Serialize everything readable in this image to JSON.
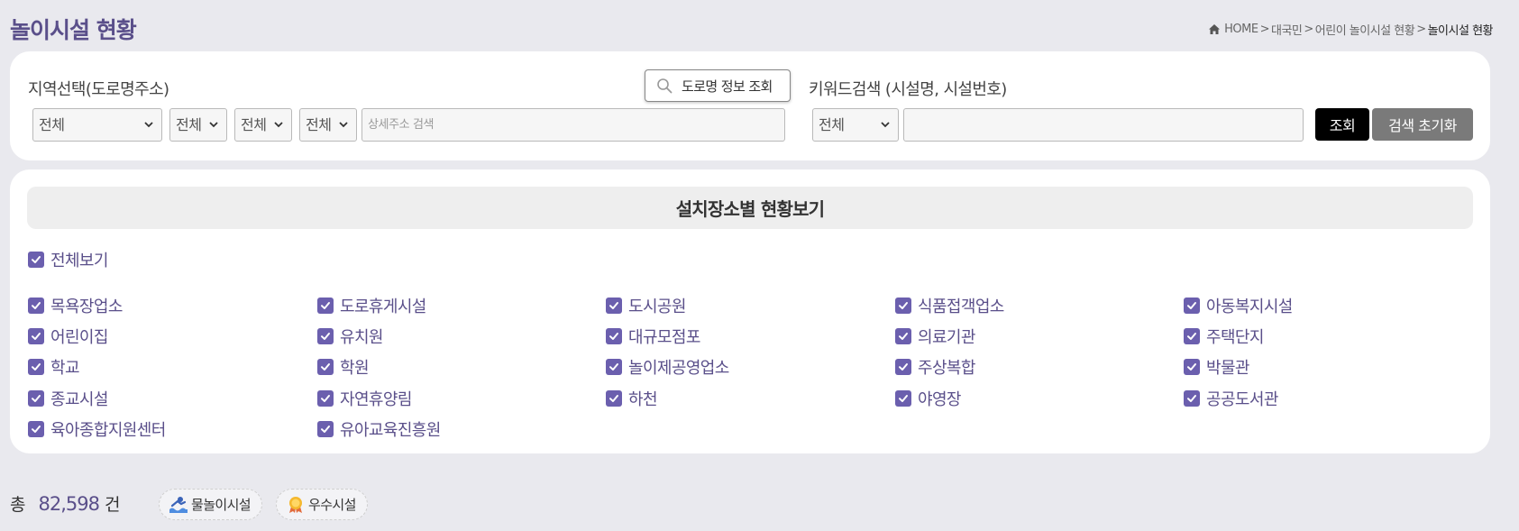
{
  "page": {
    "title": "놀이시설 현황"
  },
  "breadcrumb": {
    "items": [
      "HOME",
      "대국민",
      "어린이 놀이시설 현황"
    ],
    "separator": ">",
    "current": "놀이시설 현황"
  },
  "region_search": {
    "label": "지역선택(도로명주소)",
    "selects": [
      "전체",
      "전체",
      "전체",
      "전체"
    ],
    "detail_placeholder": "상세주소 검색",
    "road_button_label": "도로명 정보 조회"
  },
  "keyword_search": {
    "label": "키워드검색 (시설명, 시설번호)",
    "select_value": "전체",
    "input_value": "",
    "search_button_label": "조회",
    "reset_button_label": "검색 초기화"
  },
  "location_filter": {
    "header": "설치장소별 현황보기",
    "select_all_label": "전체보기",
    "select_all_checked": true,
    "options": [
      {
        "label": "목욕장업소",
        "checked": true
      },
      {
        "label": "도로휴게시설",
        "checked": true
      },
      {
        "label": "도시공원",
        "checked": true
      },
      {
        "label": "식품접객업소",
        "checked": true
      },
      {
        "label": "아동복지시설",
        "checked": true
      },
      {
        "label": "어린이집",
        "checked": true
      },
      {
        "label": "유치원",
        "checked": true
      },
      {
        "label": "대규모점포",
        "checked": true
      },
      {
        "label": "의료기관",
        "checked": true
      },
      {
        "label": "주택단지",
        "checked": true
      },
      {
        "label": "학교",
        "checked": true
      },
      {
        "label": "학원",
        "checked": true
      },
      {
        "label": "놀이제공영업소",
        "checked": true
      },
      {
        "label": "주상복합",
        "checked": true
      },
      {
        "label": "박물관",
        "checked": true
      },
      {
        "label": "종교시설",
        "checked": true
      },
      {
        "label": "자연휴양림",
        "checked": true
      },
      {
        "label": "하천",
        "checked": true
      },
      {
        "label": "야영장",
        "checked": true
      },
      {
        "label": "공공도서관",
        "checked": true
      },
      {
        "label": "육아종합지원센터",
        "checked": true
      },
      {
        "label": "유아교육진흥원",
        "checked": true
      }
    ]
  },
  "summary": {
    "total_label": "총",
    "total_count": "82,598",
    "total_unit": "건"
  },
  "legend": {
    "water": {
      "label": "물놀이시설",
      "icon": "water-play-icon"
    },
    "excellent": {
      "label": "우수시설",
      "icon": "award-medal-icon"
    }
  },
  "colors": {
    "accent": "#5a4f8a",
    "checkbox": "#6b5fae",
    "search_button": "#000000",
    "reset_button": "#7a7a7a",
    "background": "#e9e9ee"
  }
}
